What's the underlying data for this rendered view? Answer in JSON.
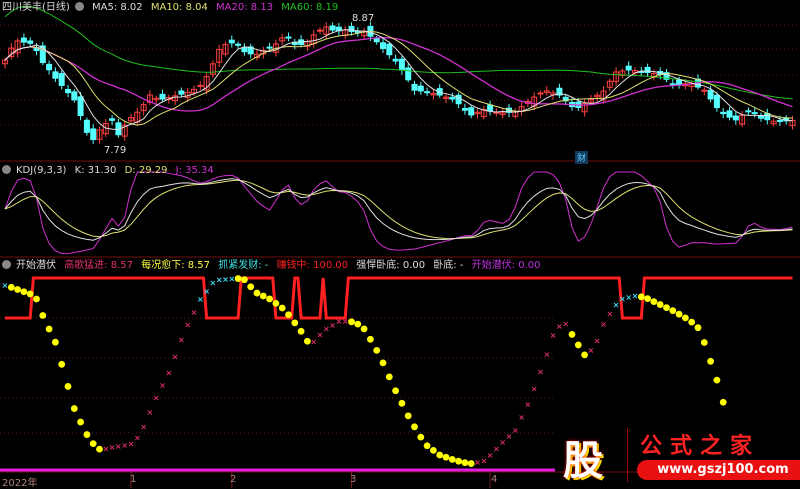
{
  "main_legend": {
    "title": "四川美丰(日线)",
    "ma5": "MA5: 8.02",
    "ma10": "MA10: 8.04",
    "ma20": "MA20: 8.13",
    "ma60": "MA60: 8.19"
  },
  "kdj_legend": {
    "title": "KDJ(9,3,3)",
    "k": "K: 31.30",
    "d": "D: 29.29",
    "j": "J: 35.34"
  },
  "ind_legend": {
    "title": "开始潜伏",
    "gaoge": "高歌猛进: 8.57",
    "meikuang": "每况愈下: 8.57",
    "zhuajin": "抓紧发财: -",
    "zhuanqian": "赚钱中: 100.00",
    "qianghan": "强悍卧底: 0.00",
    "wodi": "卧底: -",
    "kaishi": "开始潜伏: 0.00"
  },
  "annotations": {
    "high": "8.87",
    "low": "7.79",
    "badge": "财"
  },
  "axis": {
    "year": "2022年",
    "months": [
      {
        "label": "1",
        "day": 20
      },
      {
        "label": "2",
        "day": 36
      },
      {
        "label": "3",
        "day": 55
      },
      {
        "label": "4",
        "day": 77
      }
    ]
  },
  "watermark": {
    "logo": "股",
    "name": "公式之家",
    "url": "www.gszj100.com"
  },
  "colors": {
    "up": "#ff4040",
    "down": "#54ffff",
    "ma5": "#e0e0e0",
    "ma10": "#e0e070",
    "ma20": "#d030d0",
    "ma60": "#20c020",
    "k": "#e0e0e0",
    "d": "#e0e070",
    "j": "#d030d0",
    "step": "#ff2020",
    "dot": "#ffff00",
    "rise": "#e0306a",
    "top": "#40e0ff"
  },
  "chart_data": {
    "type": "line",
    "title": "四川美丰(日线)",
    "ylim": [
      7.79,
      8.87
    ],
    "close_points": [
      [
        0,
        8.52
      ],
      [
        1,
        8.62
      ],
      [
        2,
        8.68
      ],
      [
        4,
        8.66
      ],
      [
        5,
        8.6
      ],
      [
        6,
        8.5
      ],
      [
        7,
        8.44
      ],
      [
        8,
        8.37
      ],
      [
        9,
        8.31
      ],
      [
        10,
        8.25
      ],
      [
        11,
        8.19
      ],
      [
        11.5,
        8.02
      ],
      [
        12,
        8.06
      ],
      [
        13,
        7.92
      ],
      [
        14,
        7.86
      ],
      [
        15,
        7.94
      ],
      [
        15.5,
        7.98
      ],
      [
        17,
        8.02
      ],
      [
        18,
        7.9
      ],
      [
        19.5,
        8.02
      ],
      [
        21.5,
        8.11
      ],
      [
        23,
        8.23
      ],
      [
        24.5,
        8.19
      ],
      [
        26,
        8.21
      ],
      [
        27.5,
        8.23
      ],
      [
        29.5,
        8.26
      ],
      [
        31,
        8.31
      ],
      [
        32.5,
        8.42
      ],
      [
        33.8,
        8.6
      ],
      [
        35,
        8.65
      ],
      [
        36.5,
        8.67
      ],
      [
        38,
        8.59
      ],
      [
        39.7,
        8.56
      ],
      [
        41,
        8.6
      ],
      [
        42.9,
        8.65
      ],
      [
        44.5,
        8.73
      ],
      [
        46,
        8.65
      ],
      [
        47.6,
        8.65
      ],
      [
        49,
        8.73
      ],
      [
        50.8,
        8.8
      ],
      [
        52.4,
        8.76
      ],
      [
        54,
        8.77
      ],
      [
        55.6,
        8.75
      ],
      [
        57,
        8.76
      ],
      [
        58.7,
        8.69
      ],
      [
        60.3,
        8.6
      ],
      [
        61.9,
        8.52
      ],
      [
        63.5,
        8.4
      ],
      [
        65,
        8.27
      ],
      [
        66.7,
        8.26
      ],
      [
        69,
        8.23
      ],
      [
        71.4,
        8.19
      ],
      [
        73.8,
        8.06
      ],
      [
        76,
        8.11
      ],
      [
        78.6,
        8.08
      ],
      [
        81,
        8.09
      ],
      [
        83.3,
        8.19
      ],
      [
        85.7,
        8.27
      ],
      [
        88,
        8.23
      ],
      [
        90.5,
        8.11
      ],
      [
        92.9,
        8.19
      ],
      [
        95.2,
        8.27
      ],
      [
        96.8,
        8.42
      ],
      [
        99.2,
        8.44
      ],
      [
        101.6,
        8.42
      ],
      [
        104,
        8.4
      ],
      [
        106.3,
        8.31
      ],
      [
        108.7,
        8.33
      ],
      [
        111,
        8.27
      ],
      [
        113.5,
        8.09
      ],
      [
        115.9,
        8.02
      ],
      [
        118.3,
        8.11
      ],
      [
        119.8,
        8.04
      ],
      [
        122.2,
        8.01
      ],
      [
        125.4,
        8.02
      ]
    ],
    "osc_points": [
      [
        0,
        96
      ],
      [
        2.4,
        93
      ],
      [
        4.8,
        90
      ],
      [
        6.3,
        76
      ],
      [
        7.9,
        65
      ],
      [
        9.5,
        45
      ],
      [
        11.1,
        25
      ],
      [
        13.5,
        8
      ],
      [
        15.1,
        3
      ],
      [
        17.5,
        5
      ],
      [
        19.8,
        6
      ],
      [
        21.4,
        11
      ],
      [
        23.8,
        31
      ],
      [
        26.2,
        48
      ],
      [
        28.6,
        71
      ],
      [
        31,
        88
      ],
      [
        33.3,
        99
      ],
      [
        36.5,
        100
      ],
      [
        38.1,
        99
      ],
      [
        39.7,
        92
      ],
      [
        42.1,
        88
      ],
      [
        44.4,
        82
      ],
      [
        46.8,
        71
      ],
      [
        48.4,
        62
      ],
      [
        50.8,
        71
      ],
      [
        53.2,
        76
      ],
      [
        55.6,
        75
      ],
      [
        57.1,
        71
      ],
      [
        59.5,
        56
      ],
      [
        61.9,
        37
      ],
      [
        64.3,
        20
      ],
      [
        66.7,
        6
      ],
      [
        69,
        0
      ],
      [
        71.4,
        -3
      ],
      [
        73.8,
        -5
      ],
      [
        76.2,
        -3
      ],
      [
        78.6,
        6
      ],
      [
        81,
        14
      ],
      [
        83.3,
        31
      ],
      [
        85.7,
        54
      ],
      [
        87.3,
        71
      ],
      [
        88.9,
        75
      ],
      [
        90.5,
        65
      ],
      [
        92.1,
        56
      ],
      [
        93.7,
        62
      ],
      [
        95.2,
        76
      ],
      [
        97.6,
        88
      ],
      [
        100,
        90
      ],
      [
        101.6,
        89
      ],
      [
        104,
        85
      ],
      [
        106.3,
        81
      ],
      [
        108.7,
        76
      ],
      [
        110.3,
        71
      ],
      [
        111.9,
        54
      ],
      [
        113.5,
        37
      ],
      [
        115.1,
        14
      ]
    ],
    "step_low_ranges": [
      [
        0,
        4
      ],
      [
        32,
        37
      ],
      [
        43,
        45.5
      ],
      [
        47,
        50
      ],
      [
        51,
        54
      ],
      [
        98,
        101
      ]
    ],
    "last_day": 125
  }
}
